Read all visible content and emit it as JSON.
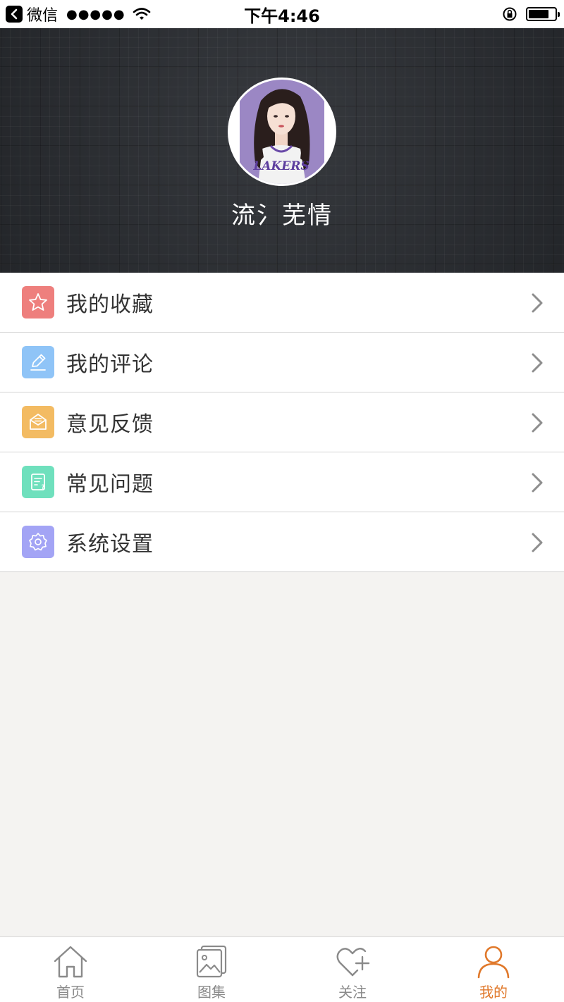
{
  "status_bar": {
    "app_name": "微信",
    "signal": "●●●●●",
    "time": "下午4:46"
  },
  "profile": {
    "username": "流氵芜情",
    "avatar_icon": "avatar-illustration"
  },
  "menu": {
    "items": [
      {
        "label": "我的收藏",
        "icon": "star-icon",
        "color": "#ee7f7d"
      },
      {
        "label": "我的评论",
        "icon": "pencil-icon",
        "color": "#8fc4f7"
      },
      {
        "label": "意见反馈",
        "icon": "envelope-icon",
        "color": "#f3bb62"
      },
      {
        "label": "常见问题",
        "icon": "faq-doc-icon",
        "color": "#6fe0bd"
      },
      {
        "label": "系统设置",
        "icon": "gear-icon",
        "color": "#a3a4f5"
      }
    ]
  },
  "tab_bar": {
    "tabs": [
      {
        "label": "首页",
        "icon": "home-icon"
      },
      {
        "label": "图集",
        "icon": "gallery-icon"
      },
      {
        "label": "关注",
        "icon": "heart-plus-icon"
      },
      {
        "label": "我的",
        "icon": "person-icon"
      }
    ],
    "active_index": 3,
    "active_color": "#e0782a",
    "inactive_color": "#8a8a8a"
  }
}
